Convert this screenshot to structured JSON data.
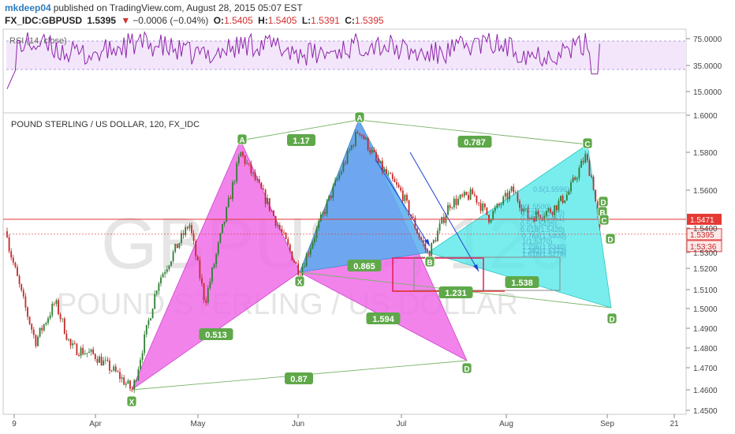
{
  "header": {
    "author": "mkdeep04",
    "published_text": "published on TradingView.com, August 28, 2015 05:07 EST",
    "symbol": "FX_IDC:GBPUSD",
    "last": "1.5395",
    "change": "−0.0006 (−0.04%)",
    "open_label": "O:",
    "open": "1.5405",
    "high_label": "H:",
    "high": "1.5405",
    "low_label": "L:",
    "low": "1.5391",
    "close_label": "C:",
    "close": "1.5395"
  },
  "rsi": {
    "label": "RSI (14, close)",
    "ticks": [
      "75.0000",
      "35.0000",
      "15.0000"
    ]
  },
  "main": {
    "title": "POUND STERLING / US DOLLAR, 120, FX_IDC",
    "watermark_big": "GBPUSD, 120",
    "watermark_small": "POUND STERLING / US DOLLAR",
    "price_ticks": [
      "1.6000",
      "1.5800",
      "1.5600",
      "1.5400",
      "1.5300",
      "1.5200",
      "1.5100",
      "1.5000",
      "1.4900",
      "1.4800",
      "1.4700",
      "1.4600",
      "1.4500"
    ],
    "x_ticks": [
      "9",
      "Apr",
      "May",
      "Jun",
      "Jul",
      "Aug",
      "Sep",
      "21"
    ],
    "price_flags": {
      "red_line": "1.5471",
      "current": "1.5395",
      "countdown": "1:53:36"
    },
    "colors": {
      "bullish_candle": "#2e7d32",
      "bearish_candle": "#c62828",
      "pattern_magenta": "#f06de8",
      "pattern_blue": "#57aef0",
      "pattern_cyan": "#58e8e8",
      "label_green": "#5fa84a",
      "red_line": "#e53935",
      "rsi_line": "#8e24aa"
    }
  },
  "chart_data": {
    "type": "candlestick",
    "title": "POUND STERLING / US DOLLAR, 120, FX_IDC",
    "ylim": [
      1.45,
      1.605
    ],
    "price_levels": {
      "horizontal_line": 1.5471,
      "current": 1.5395
    },
    "pattern1_points": [
      {
        "label": "X",
        "x": "Apr 9",
        "y": 1.4597
      },
      {
        "label": "A",
        "x": "Apr 30",
        "y": 1.5815
      },
      {
        "label": "B",
        "x": "May 28",
        "y": 1.5203
      },
      {
        "label": "C",
        "x": "Jun 18",
        "y": 1.593
      },
      {
        "label": "D",
        "x": "Jul 10",
        "y": 1.4765
      }
    ],
    "pattern2_points": [
      {
        "label": "X",
        "x": "May 28",
        "y": 1.5203
      },
      {
        "label": "A",
        "x": "Jun 18",
        "y": 1.593
      },
      {
        "label": "B",
        "x": "Jul 8",
        "y": 1.5293
      },
      {
        "label": "C",
        "x": "Aug 26",
        "y": 1.579
      },
      {
        "label": "D",
        "x": "Aug 27",
        "y": 1.501
      }
    ],
    "ratios": [
      "1.17",
      "0.787",
      "0.513",
      "1.594",
      "0.87",
      "0.865",
      "1.231",
      "1.538"
    ],
    "fib_levels": [
      "0.5(1.5596)",
      "0(1.5500)",
      "0.236(1.5470)",
      "0.382(1.5451)",
      "0.5(1.5435)",
      "0.618(1.5420)",
      "0.764(1.5400)",
      "1(1.5370)",
      "1.236(1.5340)",
      "1.382(1.5322)",
      "1.618(1.5278)"
    ],
    "rsi": {
      "levels": [
        75,
        35,
        15
      ],
      "overbought": 70,
      "oversold": 30
    }
  }
}
